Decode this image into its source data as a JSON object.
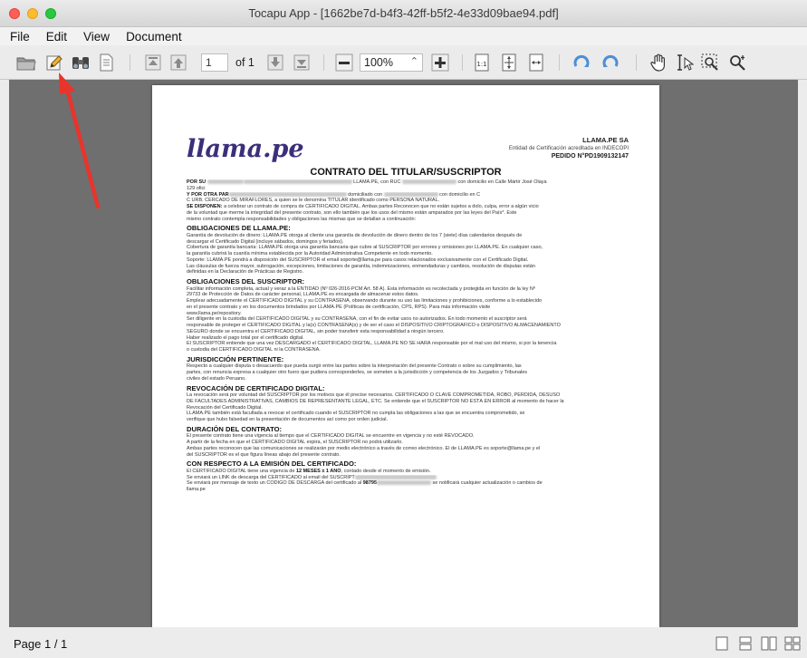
{
  "window": {
    "title": "Tocapu App - [1662be7d-b4f3-42ff-b5f2-4e33d09bae94.pdf]"
  },
  "menu": [
    "File",
    "Edit",
    "View",
    "Document"
  ],
  "toolbar": {
    "page_value": "1",
    "of_label": "of 1",
    "zoom_value": "100%"
  },
  "document": {
    "logo": "llama.pe",
    "company": "LLAMA.PE SA",
    "entidad": "Entidad de Certificación acreditada en INDECOPI",
    "pedido": "PEDIDO N°PD1909132147",
    "title": "CONTRATO DEL TITULAR/SUSCRIPTOR",
    "lines": [
      {
        "t": "p",
        "b": "POR SU ",
        "s": "",
        "blur": [
          40,
          120
        ],
        "tail": " LLAMA.PE, con RUC ",
        "blur2": 60,
        "tail2": " con domicilio en Calle Mártir José Olaya"
      },
      {
        "t": "p",
        "s": "129 ofici"
      },
      {
        "t": "p",
        "b": "Y POR OTRA PAR",
        "s": "",
        "blur": [
          130
        ],
        "tail": " domiciliado con ",
        "blur2": 60,
        "tail2": " con domicilio en C"
      },
      {
        "t": "p",
        "s": "C URB. CERCADO DE MIRAFLORES, a quien se le denomina TITULAR identificado como PERSONA NATURAL."
      },
      {
        "t": "p",
        "b": "SE DISPONEN:",
        "s": " a celebrar un contrato de compra de CERTIFICADO DIGITAL. Ambas partes Reconocen que no están sujetos a dolo, culpa, error a algún vicio"
      },
      {
        "t": "p",
        "s": "de la voluntad que merme la integridad del presente contrato, son ello también que los usos del mismo están amparados por las leyes del País*. Este"
      },
      {
        "t": "p",
        "s": "mismo contrato contempla responsabilidades y obligaciones las mismas que se detallan a continuación:"
      },
      {
        "t": "h",
        "s": "OBLIGACIONES DE LLAMA.PE:"
      },
      {
        "t": "p",
        "s": "Garantía de devolución de dinero: LLAMA.PE otorga al cliente una garantía de devolución de dinero dentro de los 7 (siete) días calendarios después de"
      },
      {
        "t": "p",
        "s": "descargar el Certificado Digital (incluye sábados, domingos y feriados)."
      },
      {
        "t": "p",
        "s": "Cobertura de garantía bancaria: LLAMA.PE otorga una garantía bancaria que cubre al SUSCRIPTOR por errores y omisiones por LLAMA.PE. En cualquier caso,"
      },
      {
        "t": "p",
        "s": "la garantía cubrirá la cuantía mínima establecida por la Autoridad Administrativa Competente en todo momento."
      },
      {
        "t": "p",
        "s": "Soporte: LLAMA.PE pondrá a disposición del SUSCRIPTOR el email soporte@llama.pe para casos relacionados exclusivamente con el Certificado Digital."
      },
      {
        "t": "p",
        "s": "Las cláusulas de fuerza mayor, subrogación, excepciones, limitaciones de garantía, indemnizaciones, enmendaduras y cambios, resolución de disputas están"
      },
      {
        "t": "p",
        "s": "definidas en la Declaración de Prácticas de Registro."
      },
      {
        "t": "h",
        "s": "OBLIGACIONES DEL SUSCRIPTOR:"
      },
      {
        "t": "p",
        "s": "Facilitar información completa, actual y veraz a la ENTIDAD (Nº 026-2016-PCM Art. 58 A). Esta información es recolectada y protegida en función de la ley Nº"
      },
      {
        "t": "p",
        "s": "29733 de Protección de Datos de carácter personal, LLAMA.PE es encargada de almacenar estos datos."
      },
      {
        "t": "p",
        "s": "Emplear adecuadamente el CERTIFICADO DIGITAL y su CONTRASEÑA, observando durante su uso las limitaciones y prohibiciones, conforme a lo establecido"
      },
      {
        "t": "p",
        "s": "en el presente contrato y en los documentos brindados por LLAMA.PE (Políticas de certificación, CPS, RPS). Para más información visite"
      },
      {
        "t": "p",
        "s": "www.llama.pe/repository."
      },
      {
        "t": "p",
        "s": "Ser diligente en la custodia del CERTIFICADO DIGITAL y su CONTRASEÑA, con el fin de evitar usos no autorizados. En todo momento el suscriptor será"
      },
      {
        "t": "p",
        "s": "responsable de proteger el CERTIFICADO DIGITAL y la(s) CONTRASEÑA(s) y de ser el caso el DISPOSITIVO CRIPTOGRÁFICO o DISPOSITIVO ALMACENAMIENTO"
      },
      {
        "t": "p",
        "s": "SEGURO donde se encuentra el CERTIFICADO DIGITAL, sin poder transferir esta responsabilidad a ningún tercero."
      },
      {
        "t": "p",
        "s": "Haber realizado el pago total por el certificado digital."
      },
      {
        "t": "p",
        "s": "El SUSCRIPTOR entiende que una vez DESCARGADO el CERTIFICADO DIGITAL, LLAMA.PE NO SE HARÁ responsable por el mal uso del mismo, si por la tenencia"
      },
      {
        "t": "p",
        "s": "o custodia del CERTIFICADO DIGITAL ni la CONTRASEÑA."
      },
      {
        "t": "h",
        "s": "JURISDICCIÓN PERTINENTE:"
      },
      {
        "t": "p",
        "s": "Respecto a cualquier disputa o desacuerdo que pueda surgir entre las partes sobre la interpretación del presente Contrato o sobre su cumplimiento, las"
      },
      {
        "t": "p",
        "s": "partes, con renuncia expresa a cualquier otro fuero que pudiera corresponderles, se someten a la jurisdicción y competencia de los Juzgados y Tribunales"
      },
      {
        "t": "p",
        "s": "civiles del estado Peruano."
      },
      {
        "t": "h",
        "s": "REVOCACIÓN DE CERTIFICADO DIGITAL:"
      },
      {
        "t": "p",
        "s": "La revocación será por voluntad del SUSCRIPTOR por los motivos que él precise necesarios. CERTIFICADO O CLAVE COMPROMETIDA, ROBO, PÉRDIDA, DESUSO"
      },
      {
        "t": "p",
        "s": "DE FACULTADES ADMINISTRATIVAS, CAMBIOS DE REPRESENTANTE LEGAL, ETC. Se entiende que el SUSCRIPTOR NO ESTÁ EN ERROR al momento de hacer la"
      },
      {
        "t": "p",
        "s": "Revocación del Certificado Digital."
      },
      {
        "t": "p",
        "s": "LLAMA.PE también está facultada a revocar el certificado cuando el SUSCRIPTOR no cumpla las obligaciones a las que se encuentra comprometido, se"
      },
      {
        "t": "p",
        "s": "verifique que hubo falsedad en la presentación de documentos así como por orden judicial."
      },
      {
        "t": "h",
        "s": "DURACIÓN DEL CONTRATO:"
      },
      {
        "t": "p",
        "s": "El presente contrato tiene una vigencia al tiempo que el CERTIFICADO DIGITAL se encuentre en vigencia y no esté REVOCADO."
      },
      {
        "t": "p",
        "s": "A partir de la fecha en que el CERTIFICADO DIGITAL expira, el SUSCRIPTOR no podrá utilizarlo."
      },
      {
        "t": "p",
        "s": "Ambas partes reconocen que las comunicaciones se realizarán por medio electrónico a través de correo electrónico. El de LLAMA.PE es soporte@llama.pe y el"
      },
      {
        "t": "p",
        "s": "del SUSCRIPTOR es el que figura líneas abajo del presente contrato."
      },
      {
        "t": "h",
        "s": "CON RESPECTO A LA EMISIÓN DEL CERTIFICADO:"
      },
      {
        "t": "p",
        "s": "El CERTIFICADO DIGITAL tiene una vigencia de ",
        "b2": "12 MESES ± 1 AÑO",
        "tail": ", contado desde el momento de emisión."
      },
      {
        "t": "p",
        "s": "Se enviará un LINK de descarga del CERTIFICADO al email del SUSCRIPT",
        "blur": [
          90
        ]
      },
      {
        "t": "p",
        "s": "Se enviará por mensaje de texto un CÓDIGO DE DESCARGA del certificado al ",
        "b2": "98795",
        "blur": [
          60
        ],
        "tail": " se notificará cualquier actualización o cambios de"
      },
      {
        "t": "p",
        "s": "llama.pe"
      }
    ]
  },
  "status": {
    "page_text": "Page 1 / 1"
  }
}
